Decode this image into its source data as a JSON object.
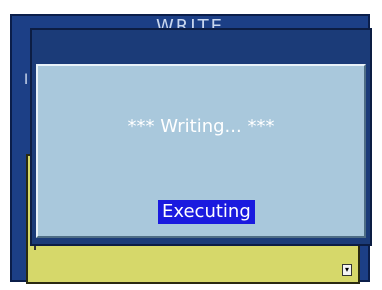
{
  "background_window": {
    "title": "WRITE",
    "left_label": "I"
  },
  "dialog": {
    "message": "*** Writing... ***",
    "status": "Executing"
  },
  "colors": {
    "window_blue": "#1c3f86",
    "dialog_body": "#a9c8dc",
    "panel_yellow": "#d6d86a",
    "status_highlight": "#1a1adf"
  }
}
